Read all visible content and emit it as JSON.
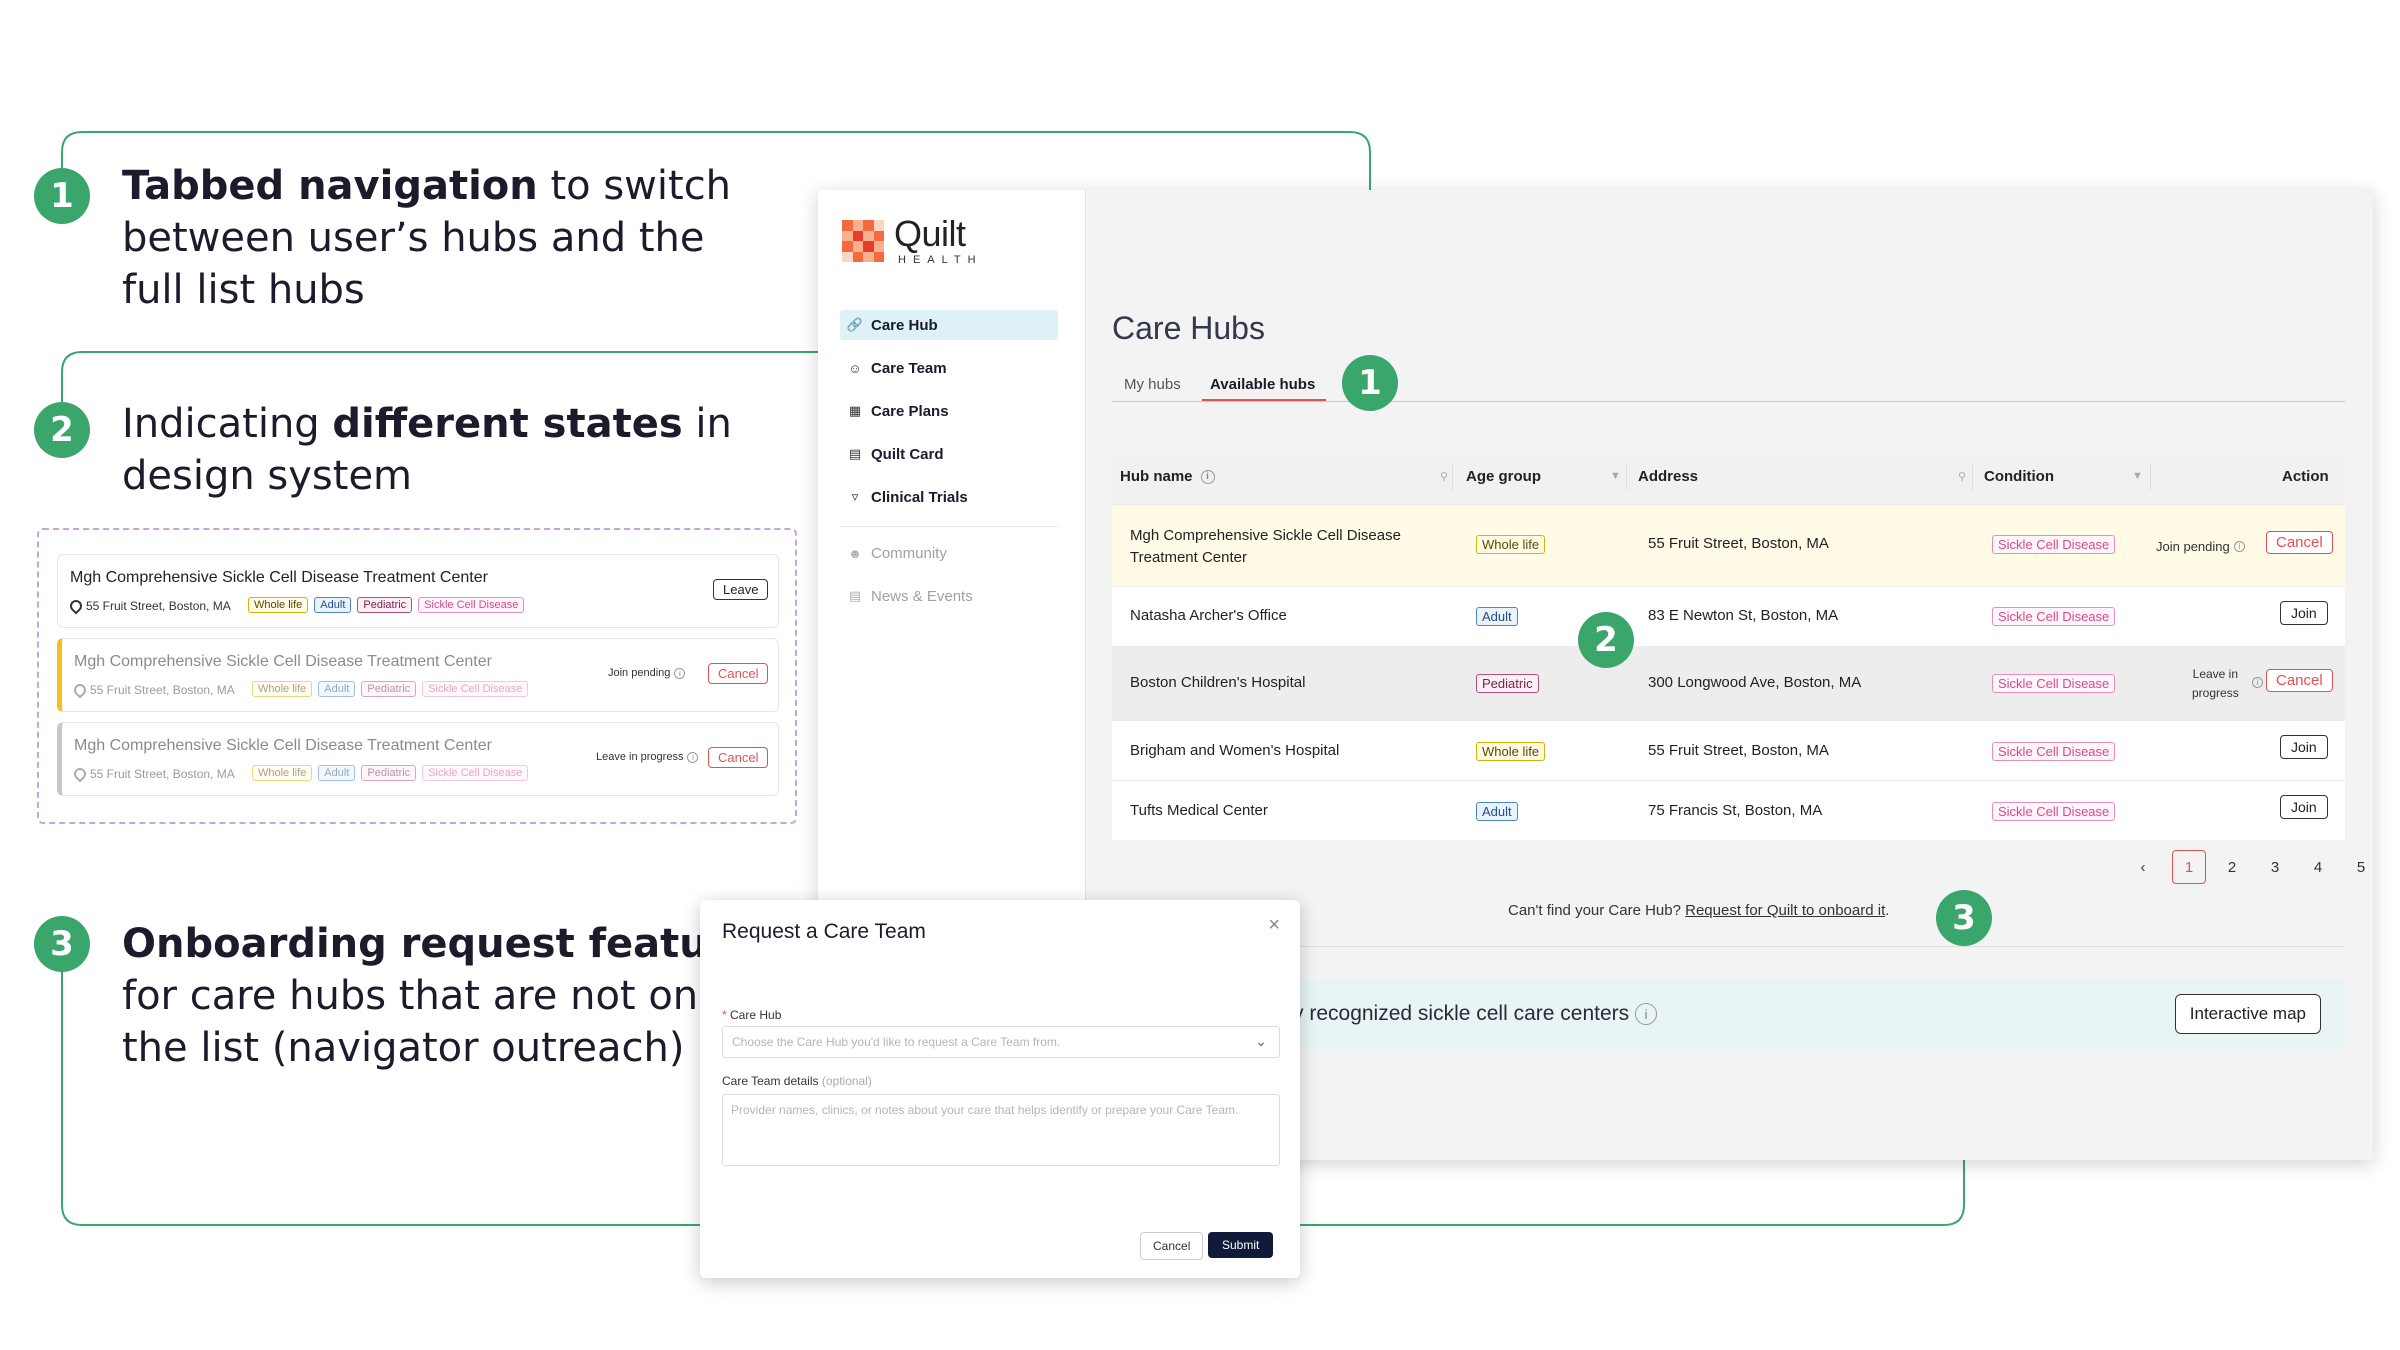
{
  "annotations": {
    "a1": {
      "number": "1",
      "bold": "Tabbed navigation",
      "rest1": " to switch",
      "line2": "between user’s hubs and the",
      "line3": "full list hubs"
    },
    "a2": {
      "number": "2",
      "pre": "Indicating ",
      "bold": "different states",
      "post": " in",
      "line2": "design system"
    },
    "a3": {
      "number": "3",
      "bold": "Onboarding request feature",
      "line2": "for care hubs that are not on",
      "line3": "the list (navigator outreach)"
    }
  },
  "states_demo": {
    "cards": [
      {
        "title": "Mgh Comprehensive Sickle Cell Disease Treatment Center",
        "address": "55 Fruit Street, Boston, MA",
        "action": "Leave",
        "status": ""
      },
      {
        "title": "Mgh Comprehensive Sickle Cell Disease Treatment Center",
        "address": "55 Fruit Street, Boston, MA",
        "action": "Cancel",
        "status": "Join pending"
      },
      {
        "title": "Mgh Comprehensive Sickle Cell Disease Treatment Center",
        "address": "55 Fruit Street, Boston, MA",
        "action": "Cancel",
        "status": "Leave in progress"
      }
    ],
    "tags": [
      "Whole life",
      "Adult",
      "Pediatric",
      "Sickle Cell Disease"
    ]
  },
  "app": {
    "logo_word": "Quilt",
    "logo_sub": "HEALTH",
    "nav": [
      {
        "label": "Care Hub",
        "icon": "link-icon"
      },
      {
        "label": "Care Team",
        "icon": "people-icon"
      },
      {
        "label": "Care Plans",
        "icon": "calendar-icon"
      },
      {
        "label": "Quilt Card",
        "icon": "card-icon"
      },
      {
        "label": "Clinical Trials",
        "icon": "flask-icon"
      },
      {
        "label": "Community",
        "icon": "community-icon"
      },
      {
        "label": "News & Events",
        "icon": "news-icon"
      }
    ],
    "page_title": "Care Hubs",
    "tabs": [
      "My hubs",
      "Available hubs"
    ],
    "table": {
      "headers": [
        "Hub name",
        "Age group",
        "Address",
        "Condition",
        "Action"
      ],
      "rows": [
        {
          "name_l1": "Mgh Comprehensive Sickle Cell Disease",
          "name_l2": "Treatment Center",
          "age": "Whole life",
          "address": "55 Fruit Street, Boston, MA",
          "condition": "Sickle Cell Disease",
          "status": "Join pending",
          "action": "Cancel"
        },
        {
          "name_l1": "Natasha Archer's Office",
          "name_l2": "",
          "age": "Adult",
          "address": "83 E Newton St, Boston, MA",
          "condition": "Sickle Cell Disease",
          "status": "",
          "action": "Join"
        },
        {
          "name_l1": "Boston Children's Hospital",
          "name_l2": "",
          "age": "Pediatric",
          "address": "300 Longwood Ave, Boston, MA",
          "condition": "Sickle Cell Disease",
          "status_l1": "Leave in",
          "status_l2": "progress",
          "action": "Cancel"
        },
        {
          "name_l1": "Brigham and Women's Hospital",
          "name_l2": "",
          "age": "Whole life",
          "address": "55 Fruit Street, Boston, MA",
          "condition": "Sickle Cell Disease",
          "status": "",
          "action": "Join"
        },
        {
          "name_l1": "Tufts Medical Center",
          "name_l2": "",
          "age": "Adult",
          "address": "75 Francis St, Boston, MA",
          "condition": "Sickle Cell Disease",
          "status": "",
          "action": "Join"
        }
      ]
    },
    "pagination": {
      "prev": "‹",
      "pages": [
        "1",
        "2",
        "3",
        "4",
        "5"
      ],
      "next": "›",
      "current": "1"
    },
    "cant_find": "Can't find your Care Hub? ",
    "cant_find_link": "Request for Quilt to onboard it",
    "cant_find_end": ".",
    "banner_text": "ally recognized sickle cell care centers",
    "map_button": "Interactive map"
  },
  "modal": {
    "title": "Request a Care Team",
    "close": "×",
    "care_hub_label": "Care Hub",
    "care_hub_placeholder": "Choose the Care Hub you'd like to request a Care Team from.",
    "details_label": "Care Team details",
    "details_optional": "(optional)",
    "details_placeholder": "Provider names, clinics, or notes about your care that helps identify or prepare your Care Team.",
    "cancel": "Cancel",
    "submit": "Submit"
  },
  "colors": {
    "accent_green": "#3aa66b",
    "danger_red": "#e05252",
    "navy": "#111a3a"
  }
}
